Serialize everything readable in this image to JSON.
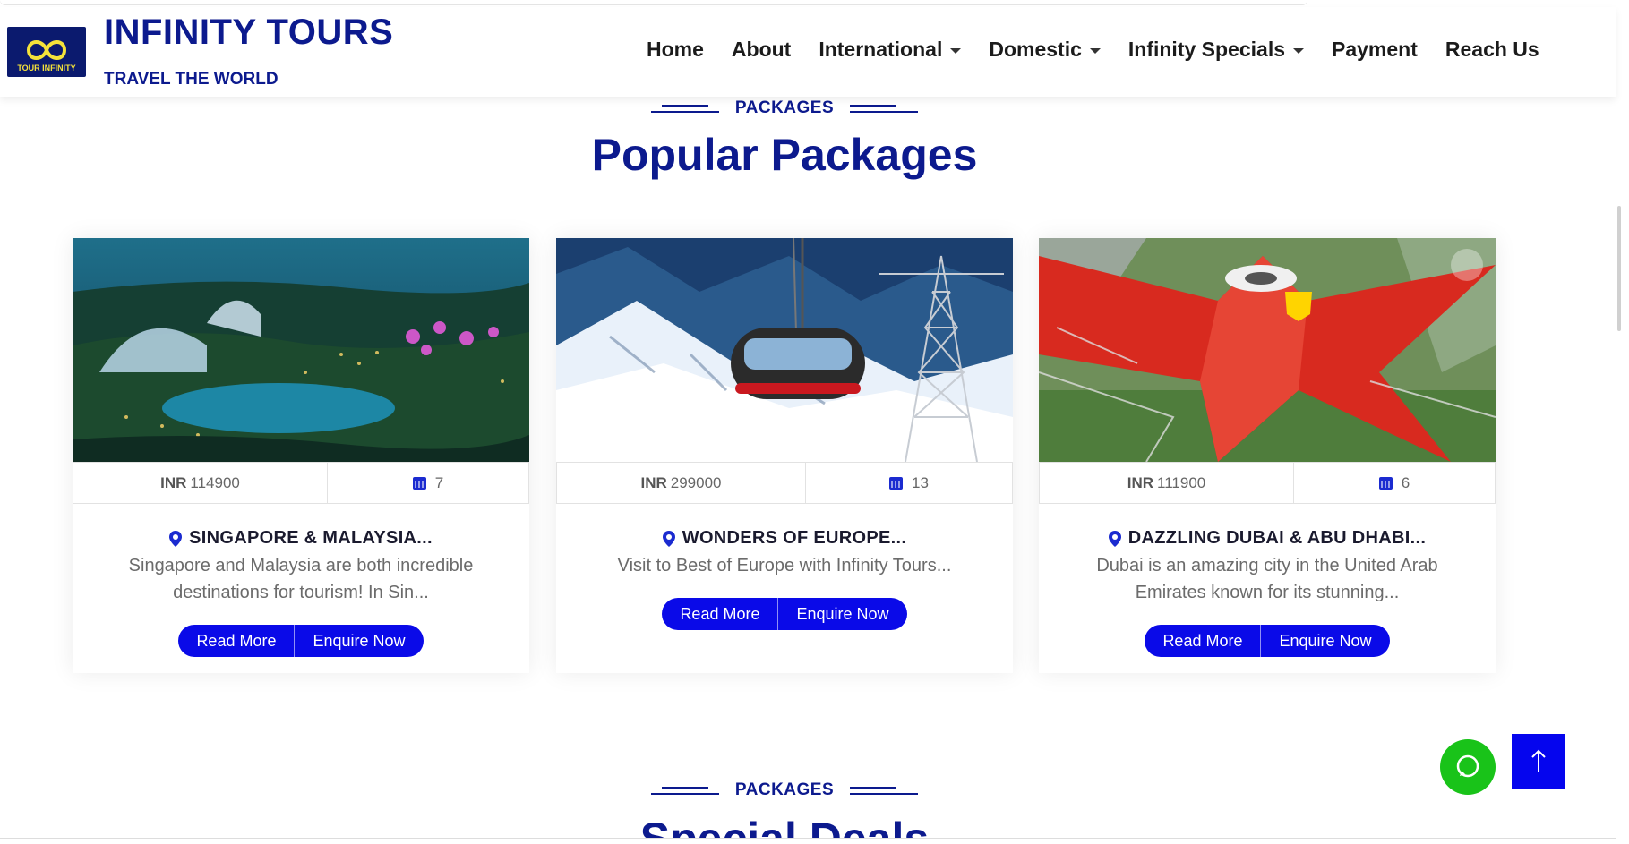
{
  "brand": {
    "title": "INFINITY TOURS",
    "subtitle": "TRAVEL THE WORLD",
    "logo_text": "TOUR INFINITY"
  },
  "nav": {
    "home": "Home",
    "about": "About",
    "international": "International",
    "domestic": "Domestic",
    "specials": "Infinity Specials",
    "payment": "Payment",
    "reach": "Reach Us"
  },
  "popular": {
    "tag": "PACKAGES",
    "title": "Popular Packages"
  },
  "special": {
    "tag": "PACKAGES",
    "title": "Special Deals"
  },
  "currency": "INR",
  "packages": [
    {
      "price": "114900",
      "days": "7",
      "title": "SINGAPORE & MALAYSIA...",
      "desc": "Singapore and Malaysia are both incredible destinations for tourism! In Sin...",
      "read_more": "Read More",
      "enquire": "Enquire Now"
    },
    {
      "price": "299000",
      "days": "13",
      "title": "WONDERS OF EUROPE...",
      "desc": "Visit to Best of Europe with Infinity Tours...",
      "read_more": "Read More",
      "enquire": "Enquire Now"
    },
    {
      "price": "111900",
      "days": "6",
      "title": "DAZZLING DUBAI & ABU DHABI...",
      "desc": "Dubai is an amazing city in the United Arab Emirates known for its stunning...",
      "read_more": "Read More",
      "enquire": "Enquire Now"
    }
  ],
  "colors": {
    "brand_blue": "#0c1a8e",
    "button_blue": "#0a0ae8",
    "whatsapp_green": "#19c319"
  },
  "icons": [
    "location-pin-icon",
    "calendar-icon",
    "whatsapp-icon",
    "arrow-up-icon",
    "lens-icon"
  ]
}
